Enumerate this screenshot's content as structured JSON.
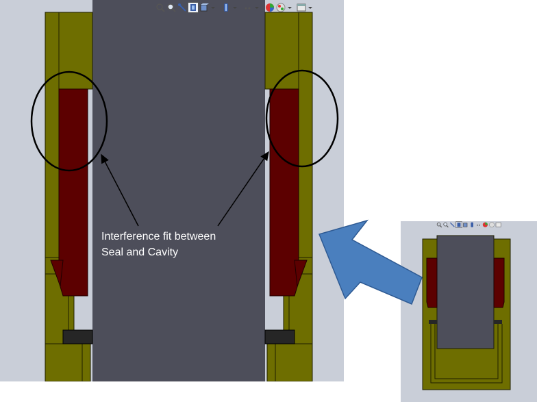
{
  "callout": {
    "line1": "Interference fit between",
    "line2": "Seal and Cavity"
  },
  "colors": {
    "background": "#c9ced8",
    "housing": "#6e6e00",
    "housing_edge": "#1e1e00",
    "piston": "#4d4e5a",
    "seal": "#5c0000",
    "backup_ring": "#262626",
    "pointer_arrow": "#4a7fbe"
  },
  "main_toolbar": {
    "icons": [
      "zoom-to-fit-icon",
      "zoom-to-area-icon",
      "previous-view-icon",
      "section-view-icon",
      "view-orientation-icon",
      "display-style-icon",
      "hide-show-items-icon",
      "edit-appearance-icon",
      "apply-scene-icon",
      "view-settings-icon"
    ]
  },
  "inset_toolbar": {
    "icons": [
      "zoom-to-fit-icon",
      "zoom-to-area-icon",
      "previous-view-icon",
      "section-view-icon",
      "view-orientation-icon",
      "display-style-icon",
      "hide-show-items-icon",
      "edit-appearance-icon",
      "apply-scene-icon",
      "view-settings-icon"
    ]
  }
}
